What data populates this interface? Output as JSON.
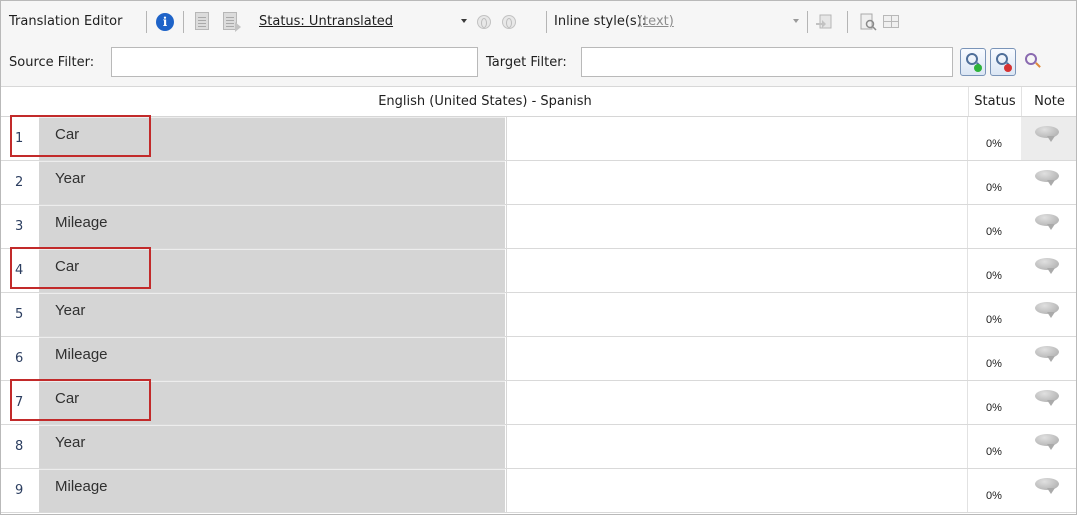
{
  "toolbar": {
    "title": "Translation Editor",
    "status_filter": "Status: Untranslated",
    "inline_style_label": "Inline style(s):",
    "inline_style_value": "(text)"
  },
  "filters": {
    "source_label": "Source Filter:",
    "source_value": "",
    "target_label": "Target Filter:",
    "target_value": ""
  },
  "table": {
    "columns": {
      "language_pair": "English (United States) - Spanish",
      "status": "Status",
      "note": "Note"
    },
    "rows": [
      {
        "num": "1",
        "source": "Car",
        "target": "",
        "status": "0%",
        "highlighted": true
      },
      {
        "num": "2",
        "source": "Year",
        "target": "",
        "status": "0%",
        "highlighted": false
      },
      {
        "num": "3",
        "source": "Mileage",
        "target": "",
        "status": "0%",
        "highlighted": false
      },
      {
        "num": "4",
        "source": "Car",
        "target": "",
        "status": "0%",
        "highlighted": true
      },
      {
        "num": "5",
        "source": "Year",
        "target": "",
        "status": "0%",
        "highlighted": false
      },
      {
        "num": "6",
        "source": "Mileage",
        "target": "",
        "status": "0%",
        "highlighted": false
      },
      {
        "num": "7",
        "source": "Car",
        "target": "",
        "status": "0%",
        "highlighted": true
      },
      {
        "num": "8",
        "source": "Year",
        "target": "",
        "status": "0%",
        "highlighted": false
      },
      {
        "num": "9",
        "source": "Mileage",
        "target": "",
        "status": "0%",
        "highlighted": false
      }
    ]
  },
  "colors": {
    "highlight_box": "#c22a2a",
    "source_cell_bg": "#d5d5d5",
    "info_icon": "#1e63c8"
  }
}
